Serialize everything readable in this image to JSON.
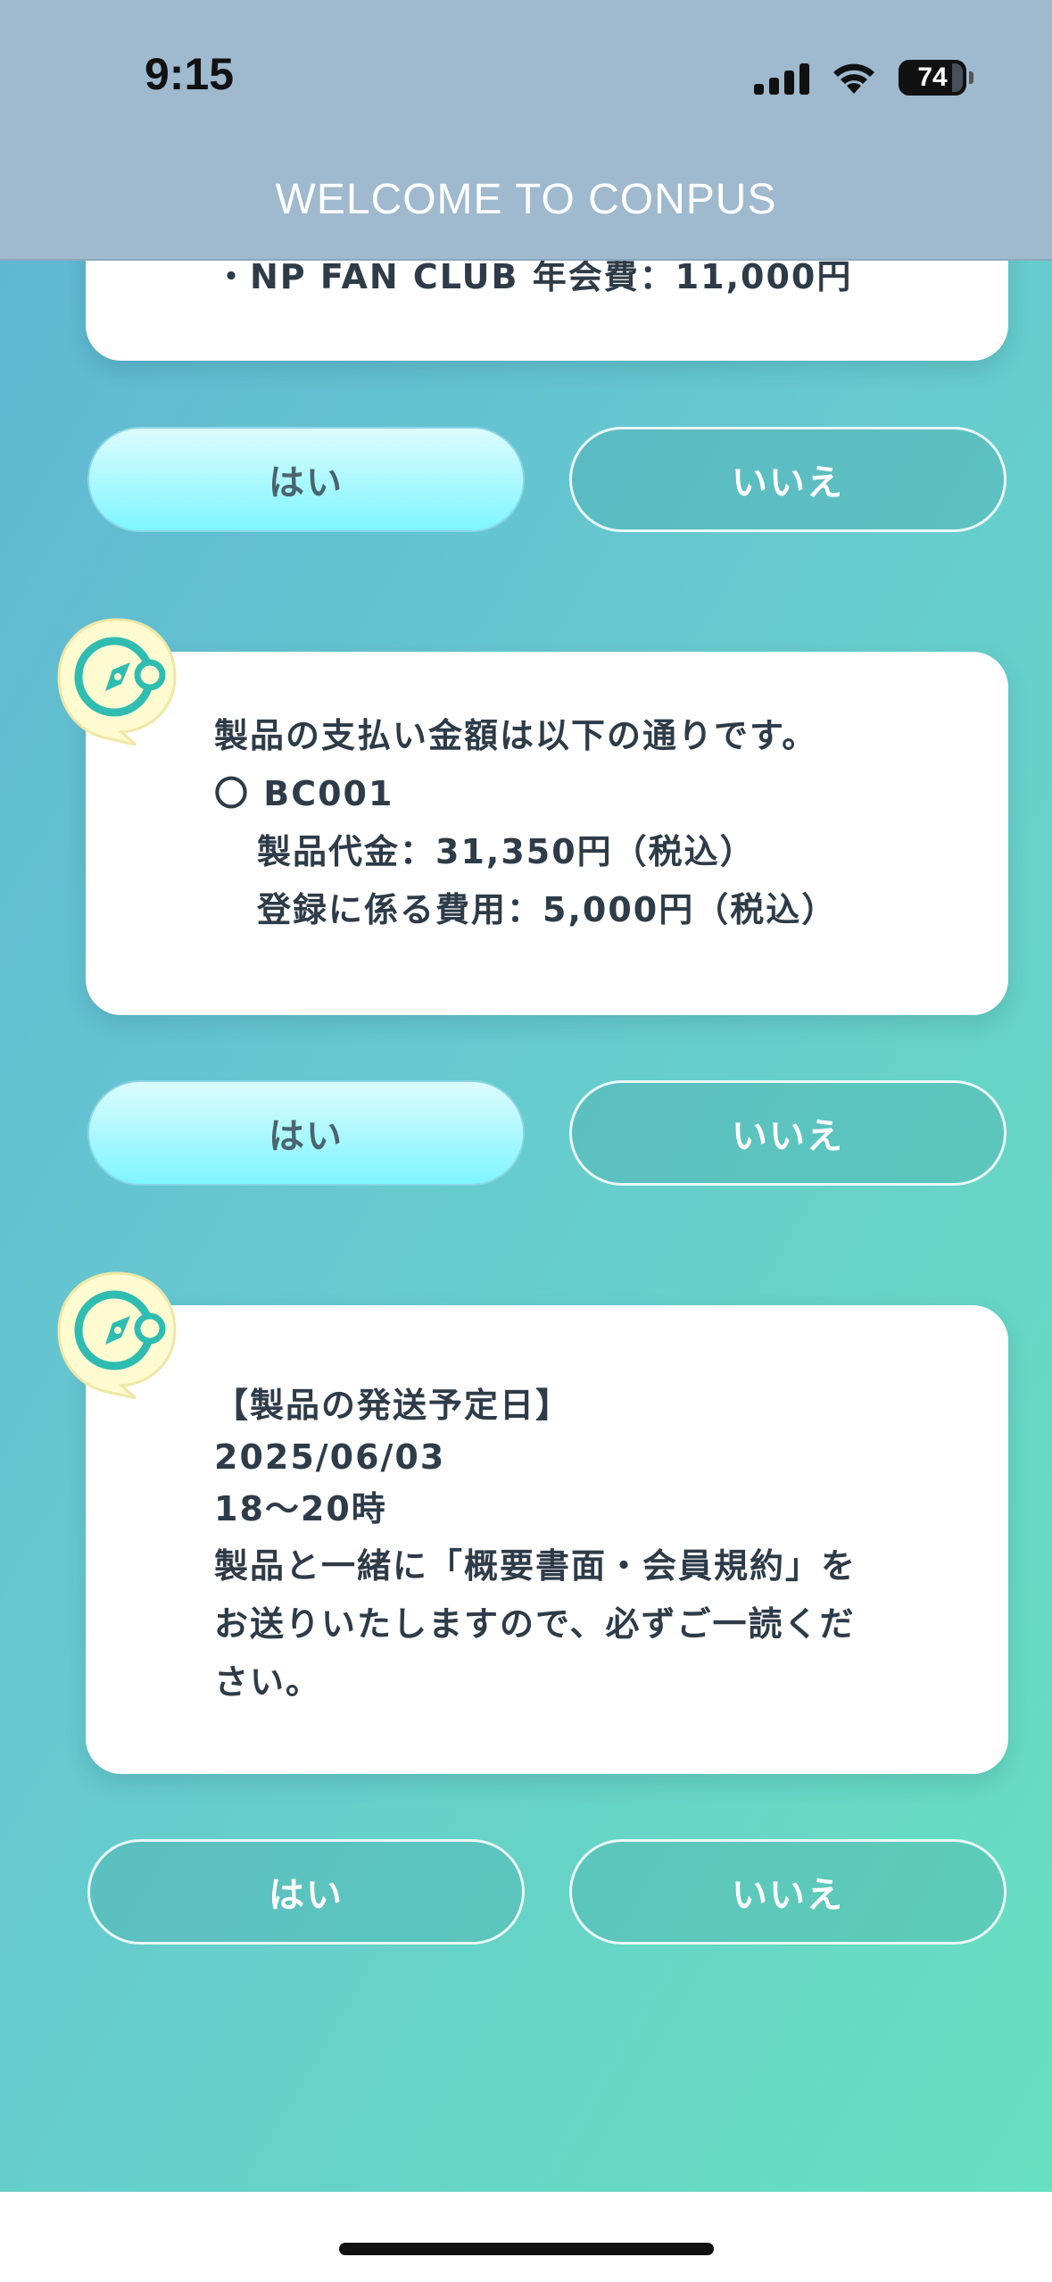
{
  "status_bar": {
    "time": "9:15",
    "battery": "74"
  },
  "header": {
    "title": "WELCOME TO CONPUS"
  },
  "cards": [
    {
      "lines": [
        "・NP FAN CLUB 年会費：11,000円"
      ]
    },
    {
      "lines": [
        "製品の支払い金額は以下の通りです。",
        "〇 BC001",
        "製品代金：31,350円（税込）",
        "登録に係る費用：5,000円（税込）"
      ]
    },
    {
      "lines": [
        "【製品の発送予定日】",
        "2025/06/03",
        "18〜20時",
        "製品と一緒に「概要書面・会員規約」を",
        "お送りいたしますので、必ずご一読くだ",
        "さい。"
      ]
    }
  ],
  "buttons": [
    {
      "yes": "はい",
      "no": "いいえ"
    },
    {
      "yes": "はい",
      "no": "いいえ"
    },
    {
      "yes": "はい",
      "no": "いいえ"
    }
  ],
  "colors": {
    "accent_blue": "#2b9bea",
    "header_bg": "#9fb9cf",
    "text_dark": "#2e3b48"
  },
  "icons": {
    "avatar": "compass-chat-icon"
  }
}
